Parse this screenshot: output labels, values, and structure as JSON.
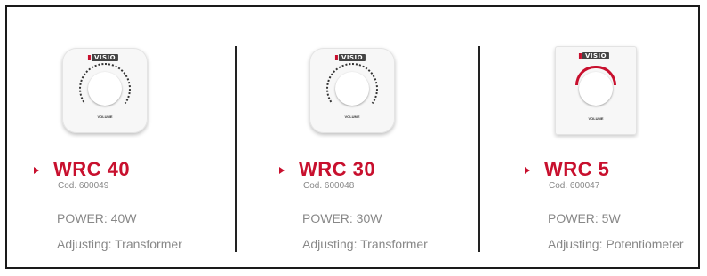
{
  "colors": {
    "accent": "#c8102e",
    "text_muted": "#888888",
    "border": "#1a1a1a"
  },
  "products": [
    {
      "name": "WRC 40",
      "code": "Cod. 600049",
      "power": "POWER: 40W",
      "adjusting": "Adjusting: Transformer",
      "device_style": "rounded-square-knob",
      "device_labels": {
        "brand": "VISIO",
        "knob": "VOLUME"
      }
    },
    {
      "name": "WRC 30",
      "code": "Cod. 600048",
      "power": "POWER: 30W",
      "adjusting": "Adjusting: Transformer",
      "device_style": "rounded-square-knob",
      "device_labels": {
        "brand": "VISIO",
        "knob": "VOLUME"
      }
    },
    {
      "name": "WRC 5",
      "code": "Cod. 600047",
      "power": "POWER: 5W",
      "adjusting": "Adjusting: Potentiometer",
      "device_style": "rectangular-plate-knob",
      "device_labels": {
        "brand": "VISIO",
        "knob": "VOLUME"
      }
    }
  ]
}
